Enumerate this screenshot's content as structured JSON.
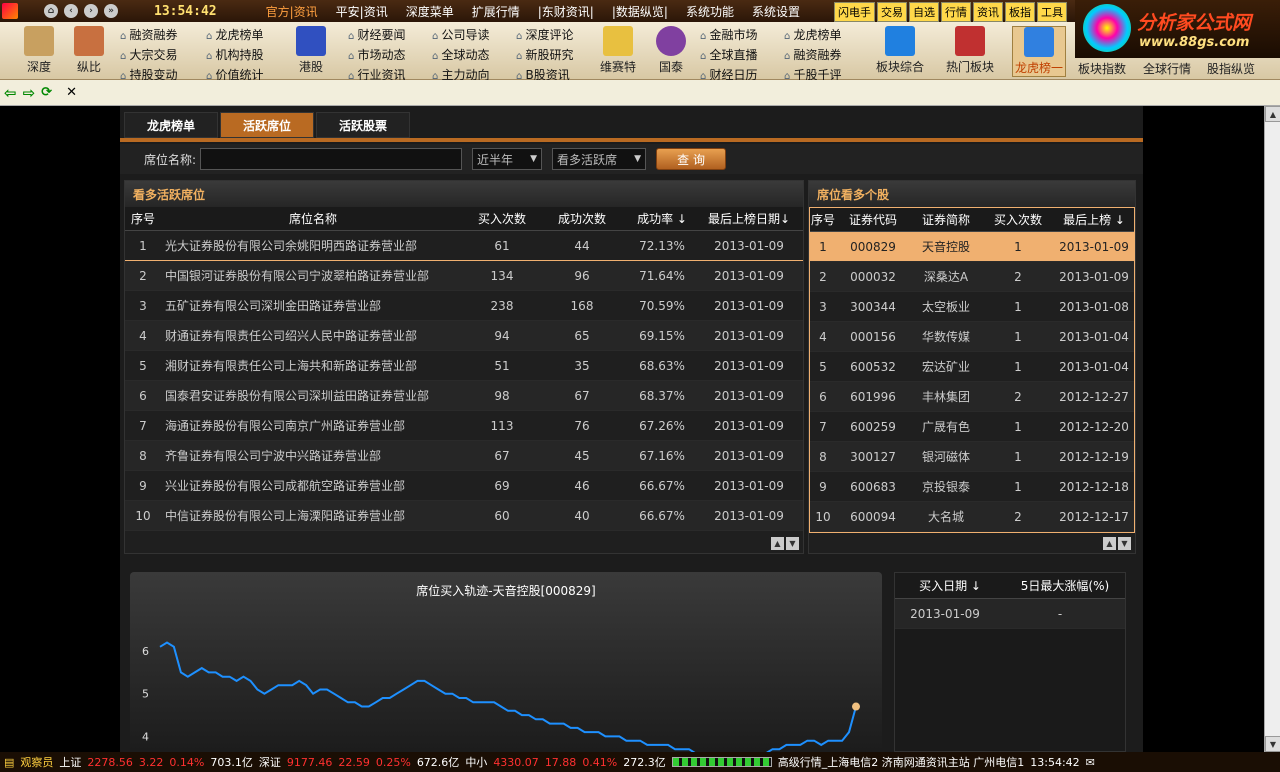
{
  "topbar": {
    "clock": "13:54:42",
    "menus": [
      "官方|资讯",
      "平安|资讯",
      "深度菜单",
      "扩展行情",
      "|东财资讯|",
      "|数据纵览|",
      "系统功能",
      "系统设置"
    ],
    "quick": [
      "闪电手",
      "交易",
      "自选",
      "行情",
      "资讯",
      "板指",
      "工具"
    ]
  },
  "logo": {
    "title": "分析家公式网",
    "url": "www.88gs.com"
  },
  "toolbar": {
    "big1": [
      "深度",
      "纵比"
    ],
    "list1": [
      "融资融券",
      "大宗交易",
      "持股变动"
    ],
    "list2": [
      "龙虎榜单",
      "机构持股",
      "价值统计"
    ],
    "big2": "港股",
    "list3": [
      "财经要闻",
      "市场动态",
      "行业资讯"
    ],
    "list4": [
      "公司导读",
      "全球动态",
      "主力动向"
    ],
    "list5": [
      "深度评论",
      "新股研究",
      "B股资讯"
    ],
    "big3": [
      "维赛特",
      "国泰"
    ],
    "list6": [
      "金融市场",
      "全球直播",
      "财经日历"
    ],
    "list7": [
      "龙虎榜单",
      "融资融券",
      "千股千评"
    ],
    "big4": [
      "板块综合",
      "热门板块",
      "龙虎榜一",
      "板块指数",
      "全球行情",
      "股指纵览"
    ]
  },
  "tabs": [
    "龙虎榜单",
    "活跃席位",
    "活跃股票"
  ],
  "filter": {
    "label": "席位名称:",
    "period": "近半年",
    "mode": "看多活跃席",
    "query": "查 询",
    "placeholder": ""
  },
  "left": {
    "title": "看多活跃席位",
    "headers": [
      "序号",
      "席位名称",
      "买入次数",
      "成功次数",
      "成功率 ↓",
      "最后上榜日期↓"
    ],
    "rows": [
      [
        "1",
        "光大证券股份有限公司余姚阳明西路证券营业部",
        "61",
        "44",
        "72.13%",
        "2013-01-09"
      ],
      [
        "2",
        "中国银河证券股份有限公司宁波翠柏路证券营业部",
        "134",
        "96",
        "71.64%",
        "2013-01-09"
      ],
      [
        "3",
        "五矿证券有限公司深圳金田路证券营业部",
        "238",
        "168",
        "70.59%",
        "2013-01-09"
      ],
      [
        "4",
        "财通证券有限责任公司绍兴人民中路证券营业部",
        "94",
        "65",
        "69.15%",
        "2013-01-09"
      ],
      [
        "5",
        "湘财证券有限责任公司上海共和新路证券营业部",
        "51",
        "35",
        "68.63%",
        "2013-01-09"
      ],
      [
        "6",
        "国泰君安证券股份有限公司深圳益田路证券营业部",
        "98",
        "67",
        "68.37%",
        "2013-01-09"
      ],
      [
        "7",
        "海通证券股份有限公司南京广州路证券营业部",
        "113",
        "76",
        "67.26%",
        "2013-01-09"
      ],
      [
        "8",
        "齐鲁证券有限公司宁波中兴路证券营业部",
        "67",
        "45",
        "67.16%",
        "2013-01-09"
      ],
      [
        "9",
        "兴业证券股份有限公司成都航空路证券营业部",
        "69",
        "46",
        "66.67%",
        "2013-01-09"
      ],
      [
        "10",
        "中信证券股份有限公司上海溧阳路证券营业部",
        "60",
        "40",
        "66.67%",
        "2013-01-09"
      ]
    ]
  },
  "right": {
    "title": "席位看多个股",
    "headers": [
      "序号",
      "证券代码",
      "证券简称",
      "买入次数",
      "最后上榜 ↓"
    ],
    "rows": [
      [
        "1",
        "000829",
        "天音控股",
        "1",
        "2013-01-09"
      ],
      [
        "2",
        "000032",
        "深桑达A",
        "2",
        "2013-01-09"
      ],
      [
        "3",
        "300344",
        "太空板业",
        "1",
        "2013-01-08"
      ],
      [
        "4",
        "000156",
        "华数传媒",
        "1",
        "2013-01-04"
      ],
      [
        "5",
        "600532",
        "宏达矿业",
        "1",
        "2013-01-04"
      ],
      [
        "6",
        "601996",
        "丰林集团",
        "2",
        "2012-12-27"
      ],
      [
        "7",
        "600259",
        "广晟有色",
        "1",
        "2012-12-20"
      ],
      [
        "8",
        "300127",
        "银河磁体",
        "1",
        "2012-12-19"
      ],
      [
        "9",
        "600683",
        "京投银泰",
        "1",
        "2012-12-18"
      ],
      [
        "10",
        "600094",
        "大名城",
        "2",
        "2012-12-17"
      ]
    ]
  },
  "chart_data": {
    "type": "line",
    "title": "席位买入轨迹-天音控股[000829]",
    "yticks": [
      "6",
      "5",
      "4"
    ],
    "ylim": [
      3.4,
      6.4
    ],
    "values": [
      6.1,
      6.2,
      6.1,
      5.5,
      5.4,
      5.5,
      5.6,
      5.5,
      5.5,
      5.4,
      5.4,
      5.3,
      5.4,
      5.3,
      5.1,
      5.0,
      5.1,
      5.2,
      5.2,
      5.2,
      5.3,
      5.2,
      5.0,
      5.1,
      5.1,
      5.0,
      4.9,
      4.8,
      4.8,
      4.7,
      4.7,
      4.8,
      4.9,
      4.9,
      5.0,
      5.1,
      5.2,
      5.3,
      5.3,
      5.2,
      5.1,
      5.0,
      5.0,
      4.9,
      4.9,
      4.8,
      4.8,
      4.8,
      4.8,
      4.7,
      4.6,
      4.6,
      4.5,
      4.5,
      4.4,
      4.4,
      4.3,
      4.3,
      4.3,
      4.2,
      4.2,
      4.1,
      4.1,
      4.1,
      4.0,
      4.0,
      4.0,
      3.9,
      3.9,
      3.9,
      3.8,
      3.8,
      3.8,
      3.8,
      3.7,
      3.7,
      3.7,
      3.6,
      3.6,
      3.6,
      3.5,
      3.5,
      3.5,
      3.5,
      3.5,
      3.6,
      3.6,
      3.6,
      3.7,
      3.7,
      3.8,
      3.8,
      3.8,
      3.9,
      3.9,
      3.8,
      3.9,
      3.9,
      3.9,
      4.1,
      4.7
    ]
  },
  "buyrec": {
    "headers": [
      "买入日期 ↓",
      "5日最大涨幅(%)"
    ],
    "rows": [
      [
        "2013-01-09",
        "-"
      ]
    ]
  },
  "status": {
    "label": "观察员",
    "sh": "上证",
    "sh_val": "2278.56",
    "sh_chg": "3.22",
    "sh_pct": "0.14%",
    "sh_amt": "703.1亿",
    "sz": "深证",
    "sz_val": "9177.46",
    "sz_chg": "22.59",
    "sz_pct": "0.25%",
    "sz_amt": "672.6亿",
    "zx": "中小",
    "zx_val": "4330.07",
    "zx_chg": "17.88",
    "zx_pct": "0.41%",
    "zx_amt": "272.3亿",
    "server": "高级行情_上海电信2 济南网通资讯主站 广州电信1",
    "time": "13:54:42"
  }
}
